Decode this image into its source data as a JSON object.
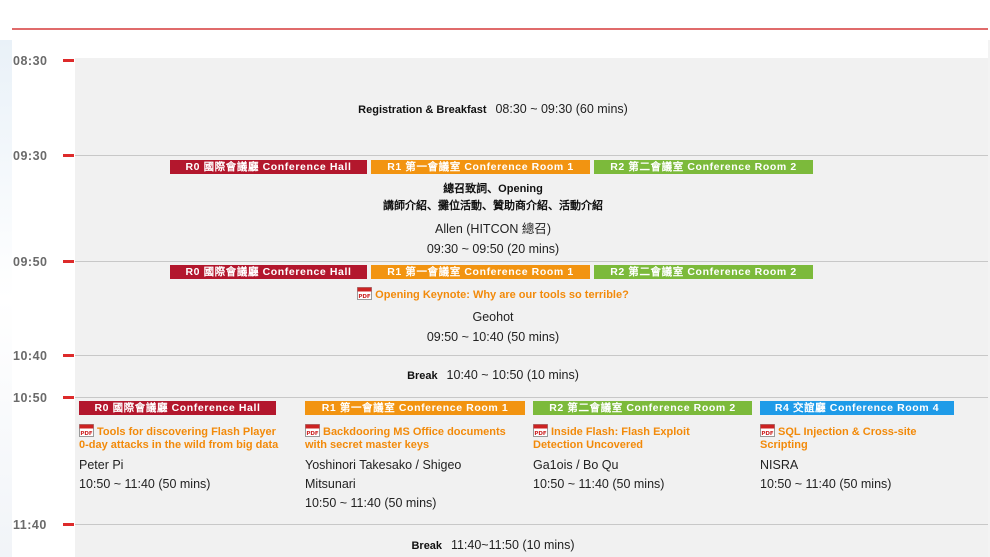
{
  "timeline": {
    "times": [
      "08:30",
      "09:30",
      "09:50",
      "10:40",
      "10:50",
      "11:40"
    ]
  },
  "rooms": {
    "r0": "R0 國際會議廳 Conference Hall",
    "r1": "R1 第一會議室 Conference Room 1",
    "r2": "R2 第二會議室 Conference Room 2",
    "r4": "R4 交誼廳 Conference Room 4"
  },
  "colors": {
    "r0": "#b3172d",
    "r1": "#f29411",
    "r2": "#7cba3b",
    "r4": "#1f9be8",
    "tick": "#dd2a2a",
    "talk_title": "#f28a0a"
  },
  "sessions": {
    "registration": {
      "title": "Registration & Breakfast",
      "time": "08:30 ~ 09:30 (60 mins)"
    },
    "opening": {
      "title_line1": "總召致詞、Opening",
      "title_line2": "講師介紹、攤位活動、贊助商介紹、活動介紹",
      "speaker": "Allen (HITCON 總召)",
      "time": "09:30 ~ 09:50 (20 mins)"
    },
    "keynote": {
      "icon": "pdf-icon",
      "title": "Opening Keynote: Why are our tools so terrible?",
      "speaker": "Geohot",
      "time": "09:50 ~ 10:40 (50 mins)"
    },
    "break1": {
      "title": "Break",
      "time": "10:40 ~ 10:50 (10 mins)"
    },
    "parallel": [
      {
        "title_line1": "Tools for discovering Flash Player",
        "title_line2": "0-day attacks in the wild from big data",
        "speaker_line1": "Peter Pi",
        "speaker_line2": "",
        "time": "10:50 ~ 11:40 (50 mins)"
      },
      {
        "title_line1": "Backdooring MS Office documents",
        "title_line2": "with secret master keys",
        "speaker_line1": "Yoshinori Takesako / Shigeo",
        "speaker_line2": "Mitsunari",
        "time": "10:50 ~ 11:40 (50 mins)"
      },
      {
        "title_line1": "Inside Flash: Flash Exploit",
        "title_line2": "Detection Uncovered",
        "speaker_line1": "Ga1ois / Bo Qu",
        "speaker_line2": "",
        "time": "10:50 ~ 11:40 (50 mins)"
      },
      {
        "title_line1": "SQL Injection & Cross-site",
        "title_line2": "Scripting",
        "speaker_line1": "NISRA",
        "speaker_line2": "",
        "time": "10:50 ~ 11:40 (50 mins)"
      }
    ],
    "break2": {
      "title": "Break",
      "time": "11:40~11:50 (10 mins)"
    }
  }
}
